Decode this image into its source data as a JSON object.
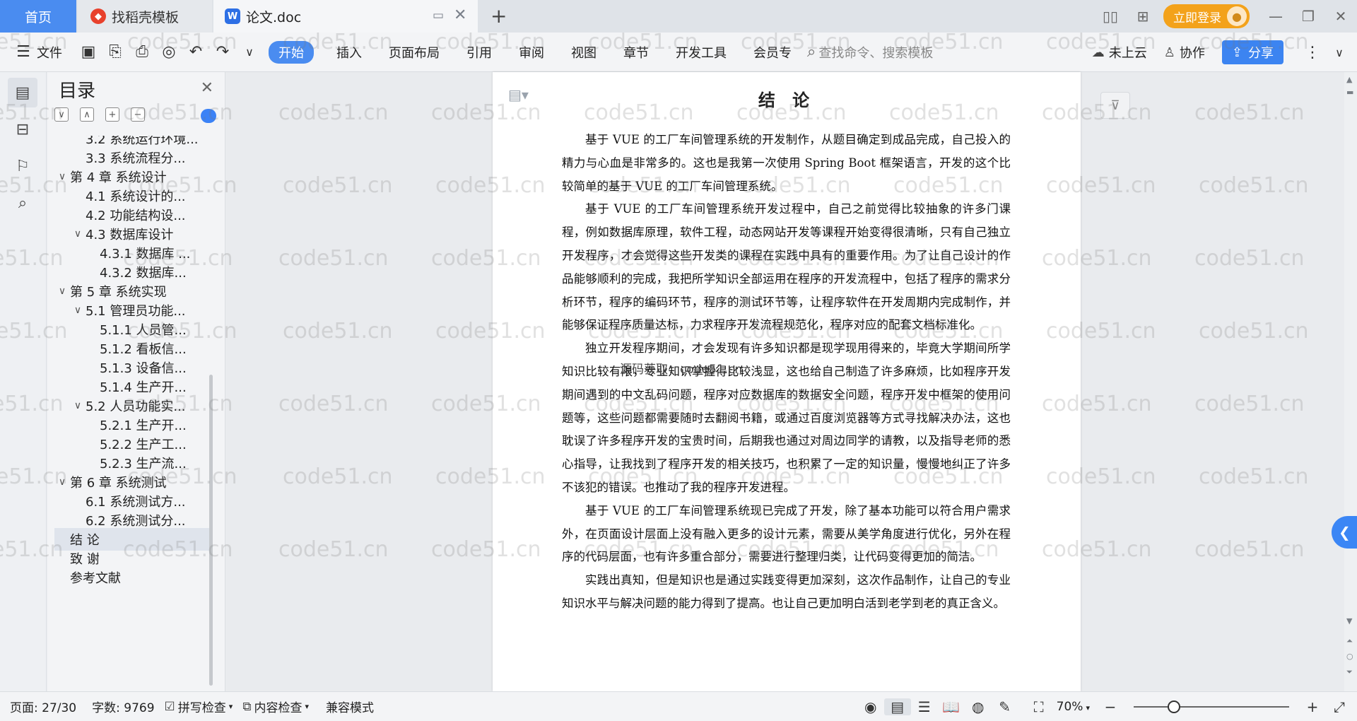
{
  "tabs": {
    "home": "首页",
    "docer": "找稻壳模板",
    "document": "论文.doc",
    "new_tab": "+"
  },
  "titlebar": {
    "login": "立即登录"
  },
  "ribbon": {
    "file": "文件",
    "menus": [
      "开始",
      "插入",
      "页面布局",
      "引用",
      "审阅",
      "视图",
      "章节",
      "开发工具",
      "会员专"
    ],
    "search_placeholder": "查找命令、搜索模板",
    "cloud": "未上云",
    "collab": "协作",
    "share": "分享"
  },
  "toc": {
    "title": "目录",
    "items": [
      {
        "level": 2,
        "label": "3.2 系统运行环境...",
        "chev": ""
      },
      {
        "level": 2,
        "label": "3.3 系统流程分...",
        "chev": ""
      },
      {
        "level": 1,
        "label": "第 4 章  系统设计",
        "chev": "∨"
      },
      {
        "level": 2,
        "label": "4.1  系统设计的...",
        "chev": ""
      },
      {
        "level": 2,
        "label": "4.2  功能结构设...",
        "chev": ""
      },
      {
        "level": 2,
        "label": "4.3  数据库设计",
        "chev": "∨"
      },
      {
        "level": 3,
        "label": "4.3.1  数据库 ...",
        "chev": ""
      },
      {
        "level": 3,
        "label": "4.3.2  数据库...",
        "chev": ""
      },
      {
        "level": 1,
        "label": "第 5 章  系统实现",
        "chev": "∨"
      },
      {
        "level": 2,
        "label": "5.1 管理员功能...",
        "chev": "∨"
      },
      {
        "level": 3,
        "label": "5.1.1  人员管...",
        "chev": ""
      },
      {
        "level": 3,
        "label": "5.1.2  看板信...",
        "chev": ""
      },
      {
        "level": 3,
        "label": "5.1.3  设备信...",
        "chev": ""
      },
      {
        "level": 3,
        "label": "5.1.4  生产开...",
        "chev": ""
      },
      {
        "level": 2,
        "label": "5.2  人员功能实...",
        "chev": "∨"
      },
      {
        "level": 3,
        "label": "5.2.1  生产开...",
        "chev": ""
      },
      {
        "level": 3,
        "label": "5.2.2  生产工...",
        "chev": ""
      },
      {
        "level": 3,
        "label": "5.2.3  生产流...",
        "chev": ""
      },
      {
        "level": 1,
        "label": "第 6 章  系统测试",
        "chev": "∨"
      },
      {
        "level": 2,
        "label": "6.1 系统测试方...",
        "chev": ""
      },
      {
        "level": 2,
        "label": "6.2  系统测试分...",
        "chev": ""
      },
      {
        "level": 1,
        "label": "结  论",
        "chev": "",
        "active": true
      },
      {
        "level": 1,
        "label": "致  谢",
        "chev": ""
      },
      {
        "level": 1,
        "label": "参考文献",
        "chev": ""
      }
    ]
  },
  "document": {
    "title": "结  论",
    "float_text": "源码获取：code51.cn",
    "paragraphs": [
      "基于 VUE 的工厂车间管理系统的开发制作，从题目确定到成品完成，自己投入的精力与心血是非常多的。这也是我第一次使用 Spring Boot 框架语言，开发的这个比较简单的基于 VUE 的工厂车间管理系统。",
      "基于 VUE 的工厂车间管理系统开发过程中，自己之前觉得比较抽象的许多门课程，例如数据库原理，软件工程，动态网站开发等课程开始变得很清晰，只有自己独立开发程序，才会觉得这些开发类的课程在实践中具有的重要作用。为了让自己设计的作品能够顺利的完成，我把所学知识全部运用在程序的开发流程中，包括了程序的需求分析环节，程序的编码环节，程序的测试环节等，让程序软件在开发周期内完成制作，并能够保证程序质量达标，力求程序开发流程规范化，程序对应的配套文档标准化。",
      "独立开发程序期间，才会发现有许多知识都是现学现用得来的，毕竟大学期间所学知识比较有限，专业知识掌握得比较浅显，这也给自己制造了许多麻烦，比如程序开发期间遇到的中文乱码问题，程序对应数据库的数据安全问题，程序开发中框架的使用问题等，这些问题都需要随时去翻阅书籍，或通过百度浏览器等方式寻找解决办法，这也耽误了许多程序开发的宝贵时间，后期我也通过对周边同学的请教，以及指导老师的悉心指导，让我找到了程序开发的相关技巧，也积累了一定的知识量，慢慢地纠正了许多不该犯的错误。也推动了我的程序开发进程。",
      "基于 VUE 的工厂车间管理系统现已完成了开发，除了基本功能可以符合用户需求外，在页面设计层面上没有融入更多的设计元素，需要从美学角度进行优化，另外在程序的代码层面，也有许多重合部分，需要进行整理归类，让代码变得更加的简洁。",
      "实践出真知，但是知识也是通过实践变得更加深刻，这次作品制作，让自己的专业知识水平与解决问题的能力得到了提高。也让自己更加明白活到老学到老的真正含义。"
    ]
  },
  "watermark": "code51.cn",
  "status": {
    "page": "页面: 27/30",
    "words": "字数: 9769",
    "spell_check": "拼写检查",
    "content_check": "内容检查",
    "compat_mode": "兼容模式",
    "zoom": "70%",
    "zoom_level": 0.26
  },
  "colors": {
    "accent": "#4a8cf0",
    "login": "#f3a21b",
    "share": "#3c84f1"
  }
}
